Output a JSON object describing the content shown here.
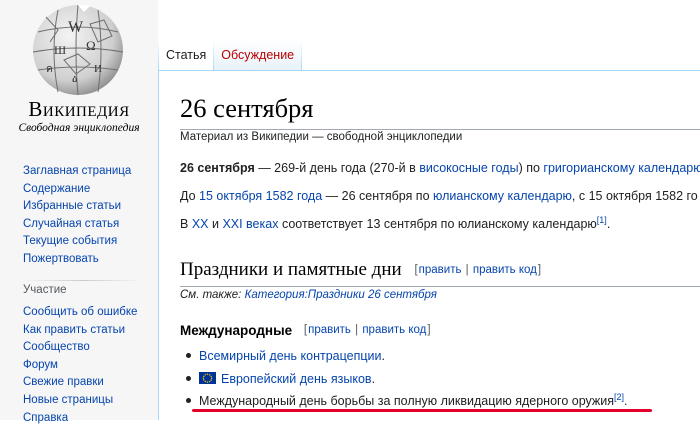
{
  "logo": {
    "wordmark": "Википедия",
    "tagline": "Свободная энциклопедия"
  },
  "sidebar": {
    "main_items": [
      {
        "label": "Заглавная страница"
      },
      {
        "label": "Содержание"
      },
      {
        "label": "Избранные статьи"
      },
      {
        "label": "Случайная статья"
      },
      {
        "label": "Текущие события"
      },
      {
        "label": "Пожертвовать"
      }
    ],
    "participation_heading": "Участие",
    "participation_items": [
      {
        "label": "Сообщить об ошибке"
      },
      {
        "label": "Как править статьи"
      },
      {
        "label": "Сообщество"
      },
      {
        "label": "Форум"
      },
      {
        "label": "Свежие правки"
      },
      {
        "label": "Новые страницы"
      },
      {
        "label": "Справка"
      }
    ]
  },
  "tabs": {
    "article": "Статья",
    "talk": "Обсуждение"
  },
  "article": {
    "title": "26 сентября",
    "site_sub": "Материал из Википедии — свободной энциклопедии",
    "p1": {
      "bold": "26 сентября",
      "text1": " — 269-й день года (270-й в ",
      "link1": "високосные годы",
      "text2": ") по ",
      "link2": "григорианскому календарю"
    },
    "p2": {
      "text1": "До ",
      "link1": "15 октября 1582 года",
      "text2": " — 26 сентября по ",
      "link2": "юлианскому календарю",
      "text3": ", с 15 октября 1582 го"
    },
    "p3": {
      "text1": "В ",
      "link1": "XX",
      "text2": " и ",
      "link2": "XXI веках",
      "text3": " соответствует 13 сентября по юлианскому календарю",
      "ref": "[1]",
      "text4": "."
    },
    "section": {
      "title": "Праздники и памятные дни",
      "bracket_open": "[",
      "edit": "править",
      "sep": "|",
      "edit_code": "править код",
      "bracket_close": "]",
      "see_also_prefix": "См. также: ",
      "see_also_link": "Категория:Праздники 26 сентября"
    },
    "subsection": {
      "title": "Международные",
      "bracket_open": "[",
      "edit": "править",
      "sep": "|",
      "edit_code": "править код",
      "bracket_close": "]"
    },
    "list": [
      {
        "text": "Всемирный день контрацепции",
        "suffix": "."
      },
      {
        "text": "Европейский день языков",
        "suffix": ".",
        "icon": "eu-flag-icon"
      },
      {
        "text": "Международный день борьбы за полную ликвидацию ядерного оружия",
        "ref": "[2]",
        "suffix": "."
      }
    ]
  },
  "colors": {
    "link": "#0645ad",
    "new_link": "#ba0000",
    "sidebar_bg": "#f6f6f6",
    "tab_border": "#a7d7f9",
    "highlight_underline": "#e4002b"
  }
}
